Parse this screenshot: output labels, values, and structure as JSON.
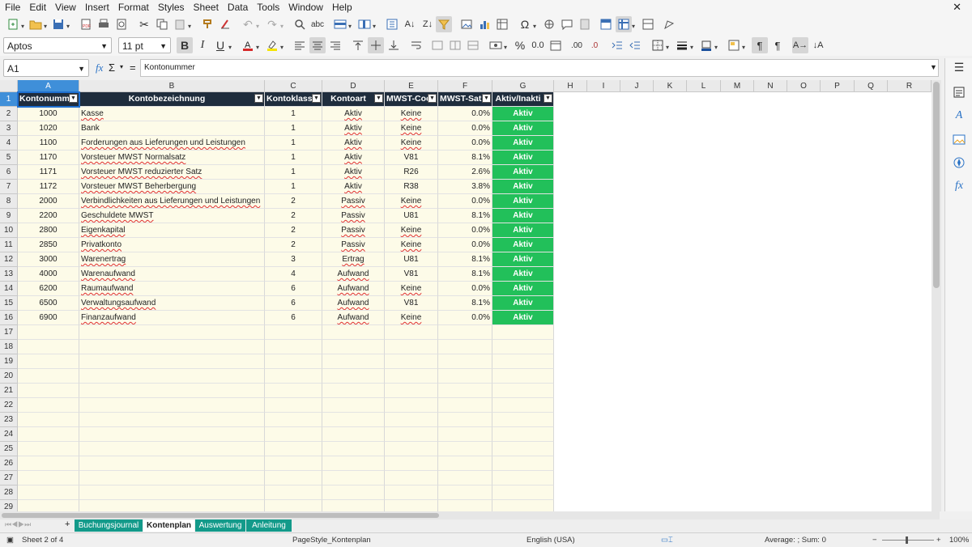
{
  "menu": [
    "File",
    "Edit",
    "View",
    "Insert",
    "Format",
    "Styles",
    "Sheet",
    "Data",
    "Tools",
    "Window",
    "Help"
  ],
  "menu_close": "✕",
  "toolbar": {
    "font_name": "Aptos",
    "font_size": "11 pt",
    "bold": "B",
    "italic": "I",
    "underline": "U",
    "percent": "%",
    "decimal_std": "0.0",
    "add_decimal": ".00",
    "del_decimal": ".0"
  },
  "formula_bar": {
    "name_box": "A1",
    "content": "Kontonummer",
    "fx": "fx",
    "sigma": "Σ",
    "equals": "="
  },
  "columns": [
    "A",
    "B",
    "C",
    "D",
    "E",
    "F",
    "G",
    "H",
    "I",
    "J",
    "K",
    "L",
    "M",
    "N",
    "O",
    "P",
    "Q",
    "R"
  ],
  "header_row": [
    "Kontonumm",
    "Kontobezeichnung",
    "Kontoklass",
    "Kontoart",
    "MWST-Coc",
    "MWST-Sat",
    "Aktiv/Inakti"
  ],
  "rows": [
    {
      "n": "2",
      "a": "1000",
      "b": "Kasse",
      "c": "1",
      "d": "Aktiv",
      "e": "Keine",
      "f": "0.0%",
      "g": "Aktiv"
    },
    {
      "n": "3",
      "a": "1020",
      "b": "Bank",
      "c": "1",
      "d": "Aktiv",
      "e": "Keine",
      "f": "0.0%",
      "g": "Aktiv"
    },
    {
      "n": "4",
      "a": "1100",
      "b": "Forderungen aus Lieferungen und Leistungen",
      "c": "1",
      "d": "Aktiv",
      "e": "Keine",
      "f": "0.0%",
      "g": "Aktiv"
    },
    {
      "n": "5",
      "a": "1170",
      "b": "Vorsteuer MWST Normalsatz",
      "c": "1",
      "d": "Aktiv",
      "e": "V81",
      "f": "8.1%",
      "g": "Aktiv"
    },
    {
      "n": "6",
      "a": "1171",
      "b": "Vorsteuer MWST reduzierter Satz",
      "c": "1",
      "d": "Aktiv",
      "e": "R26",
      "f": "2.6%",
      "g": "Aktiv"
    },
    {
      "n": "7",
      "a": "1172",
      "b": "Vorsteuer MWST Beherbergung",
      "c": "1",
      "d": "Aktiv",
      "e": "R38",
      "f": "3.8%",
      "g": "Aktiv"
    },
    {
      "n": "8",
      "a": "2000",
      "b": "Verbindlichkeiten aus Lieferungen und Leistungen",
      "c": "2",
      "d": "Passiv",
      "e": "Keine",
      "f": "0.0%",
      "g": "Aktiv"
    },
    {
      "n": "9",
      "a": "2200",
      "b": "Geschuldete MWST",
      "c": "2",
      "d": "Passiv",
      "e": "U81",
      "f": "8.1%",
      "g": "Aktiv"
    },
    {
      "n": "10",
      "a": "2800",
      "b": "Eigenkapital",
      "c": "2",
      "d": "Passiv",
      "e": "Keine",
      "f": "0.0%",
      "g": "Aktiv"
    },
    {
      "n": "11",
      "a": "2850",
      "b": "Privatkonto",
      "c": "2",
      "d": "Passiv",
      "e": "Keine",
      "f": "0.0%",
      "g": "Aktiv"
    },
    {
      "n": "12",
      "a": "3000",
      "b": "Warenertrag",
      "c": "3",
      "d": "Ertrag",
      "e": "U81",
      "f": "8.1%",
      "g": "Aktiv"
    },
    {
      "n": "13",
      "a": "4000",
      "b": "Warenaufwand",
      "c": "4",
      "d": "Aufwand",
      "e": "V81",
      "f": "8.1%",
      "g": "Aktiv"
    },
    {
      "n": "14",
      "a": "6200",
      "b": "Raumaufwand",
      "c": "6",
      "d": "Aufwand",
      "e": "Keine",
      "f": "0.0%",
      "g": "Aktiv"
    },
    {
      "n": "15",
      "a": "6500",
      "b": "Verwaltungsaufwand",
      "c": "6",
      "d": "Aufwand",
      "e": "V81",
      "f": "8.1%",
      "g": "Aktiv"
    },
    {
      "n": "16",
      "a": "6900",
      "b": "Finanzaufwand",
      "c": "6",
      "d": "Aufwand",
      "e": "Keine",
      "f": "0.0%",
      "g": "Aktiv"
    }
  ],
  "empty_rows": [
    "17",
    "18",
    "19",
    "20",
    "21",
    "22",
    "23",
    "24",
    "25",
    "26",
    "27",
    "28",
    "29"
  ],
  "row1_label": "1",
  "sheet_tabs": [
    "Buchungsjournal",
    "Kontenplan",
    "Auswertung",
    "Anleitung"
  ],
  "active_tab": "Kontenplan",
  "add_sheet": "+",
  "status": {
    "sheet": "Sheet 2 of 4",
    "page_style": "PageStyle_Kontenplan",
    "language": "English (USA)",
    "summary": "Average: ; Sum: 0",
    "zoom": "100%",
    "zoom_minus": "−",
    "zoom_plus": "+"
  },
  "colors": {
    "accent": "#3f8fd9",
    "header_bg": "#1f2d3d",
    "aktiv": "#22c05a",
    "tab": "#139a8a",
    "cell_fill": "#fdfbe8"
  }
}
